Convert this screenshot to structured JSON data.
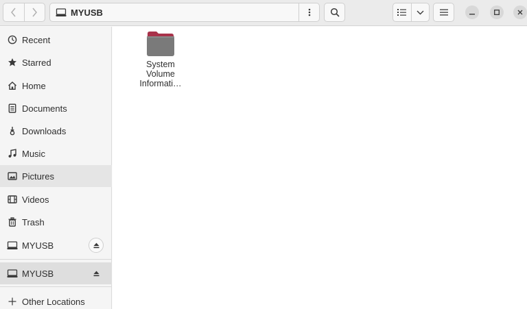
{
  "header": {
    "location": "MYUSB",
    "icons": {
      "back": "chevron-left-icon",
      "forward": "chevron-right-icon",
      "drive": "drive-icon",
      "path_menu": "vertical-dots-icon",
      "search": "search-icon",
      "view": "list-view-icon",
      "view_options": "chevron-down-icon",
      "main_menu": "hamburger-icon",
      "minimize": "minimize-icon",
      "maximize": "maximize-icon",
      "close": "close-icon"
    }
  },
  "sidebar": {
    "items": [
      {
        "label": "Recent",
        "icon": "clock-icon"
      },
      {
        "label": "Starred",
        "icon": "star-icon"
      },
      {
        "label": "Home",
        "icon": "home-icon"
      },
      {
        "label": "Documents",
        "icon": "document-icon"
      },
      {
        "label": "Downloads",
        "icon": "download-icon"
      },
      {
        "label": "Music",
        "icon": "music-icon"
      },
      {
        "label": "Pictures",
        "icon": "picture-icon"
      },
      {
        "label": "Videos",
        "icon": "video-icon"
      },
      {
        "label": "Trash",
        "icon": "trash-icon"
      },
      {
        "label": "MYUSB",
        "icon": "drive-icon"
      },
      {
        "label": "MYUSB",
        "icon": "drive-icon"
      },
      {
        "label": "Other Locations",
        "icon": "plus-icon"
      }
    ]
  },
  "files": [
    {
      "name": "System Volume Informati…",
      "icon": "folder-icon",
      "color": "#7a7a7a",
      "tab_color": "#a8324a"
    }
  ]
}
